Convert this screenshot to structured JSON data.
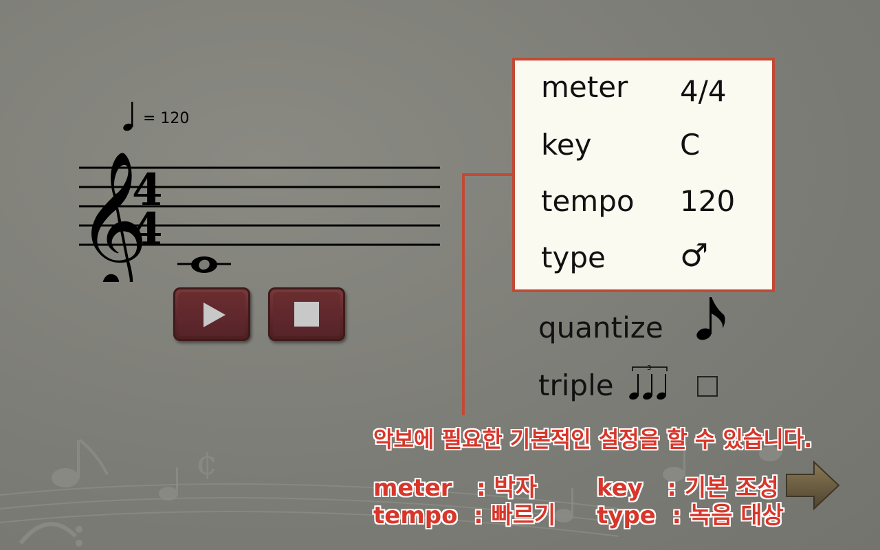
{
  "tempo_marking": {
    "value": "= 120"
  },
  "settings": {
    "meter": {
      "label": "meter",
      "value": "4/4"
    },
    "key": {
      "label": "key",
      "value": "C"
    },
    "tempo": {
      "label": "tempo",
      "value": "120"
    },
    "type": {
      "label": "type",
      "value": "♂"
    }
  },
  "options": {
    "quantize": {
      "label": "quantize"
    },
    "triple": {
      "label": "triple",
      "checked": false
    }
  },
  "help": {
    "headline": "악보에 필요한 기본적인 설정을 할 수 있습니다.",
    "meter_desc": "meter   : 박자",
    "tempo_desc": "tempo  : 빠르기",
    "key_desc": "key   : 기본 조성",
    "type_desc": "type  : 녹음 대상"
  },
  "colors": {
    "accent": "#c04a36",
    "panel_bg": "#fbfaf1",
    "button": "#5c2628",
    "help_text": "#d8362a"
  },
  "icons": {
    "play": "play-icon",
    "stop": "stop-icon",
    "next": "arrow-right-icon",
    "quantize": "eighth-note-icon",
    "triple": "triplet-icon"
  }
}
